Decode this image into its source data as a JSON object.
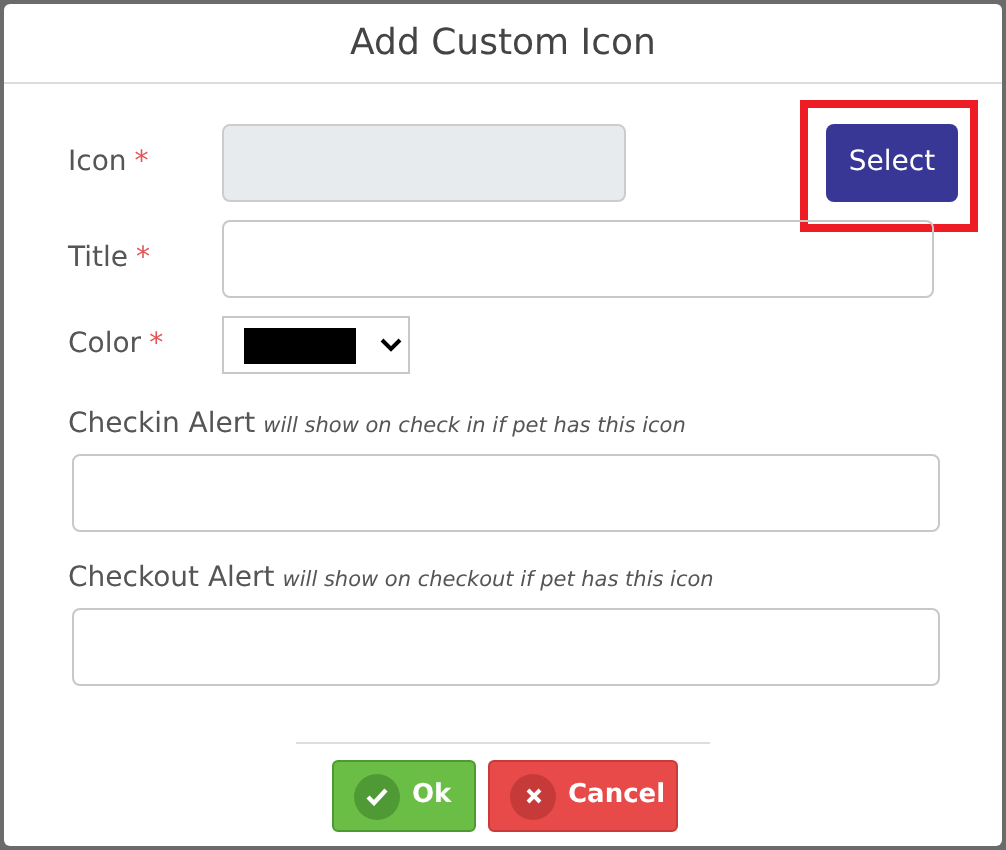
{
  "dialog": {
    "title": "Add Custom Icon"
  },
  "fields": [
    {
      "kind": "readonly",
      "label": "Icon",
      "mark": "*",
      "button": {
        "label": "Select",
        "highlighted": true
      }
    },
    {
      "kind": "text",
      "label": "Title",
      "mark": "*"
    },
    {
      "kind": "color",
      "label": "Color",
      "mark": "*",
      "color": "#000000"
    }
  ],
  "alerts": [
    {
      "label": "Checkin Alert",
      "hint": "will show on check in if pet has this icon"
    },
    {
      "label": "Checkout Alert",
      "hint": "will show on checkout if pet has this icon"
    }
  ],
  "buttons": [
    {
      "kind": "ok",
      "label": "Ok"
    },
    {
      "kind": "cancel",
      "label": "Cancel"
    }
  ]
}
